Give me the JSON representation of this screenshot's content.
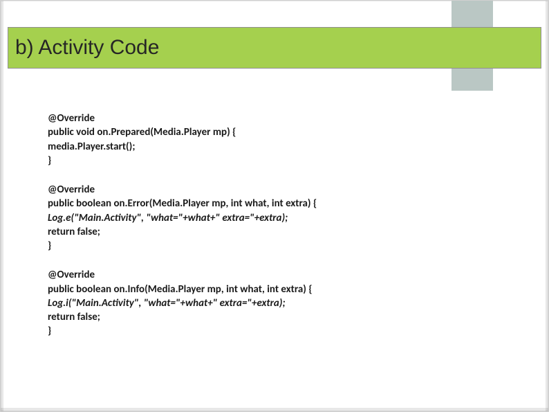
{
  "title": "b) Activity Code",
  "blocks": [
    {
      "lines": [
        {
          "text": "@Override",
          "style": "bold"
        },
        {
          "text": "public void on.Prepared(Media.Player mp) {",
          "style": "bold"
        },
        {
          "text": "media.Player.start();",
          "style": "bold"
        },
        {
          "text": "}",
          "style": "bold"
        }
      ]
    },
    {
      "lines": [
        {
          "text": "@Override",
          "style": "bold"
        },
        {
          "text": "public boolean on.Error(Media.Player mp, int what, int extra) {",
          "style": "bold"
        },
        {
          "text": "Log.e(\"Main.Activity\", \"what=\"+what+\" extra=\"+extra);",
          "style": "italic"
        },
        {
          "text": "return false;",
          "style": "bold"
        },
        {
          "text": "}",
          "style": "bold"
        }
      ]
    },
    {
      "lines": [
        {
          "text": "@Override",
          "style": "bold"
        },
        {
          "text": "public boolean on.Info(Media.Player mp, int what, int extra) {",
          "style": "bold"
        },
        {
          "text": "Log.i(\"Main.Activity\", \"what=\"+what+\" extra=\"+extra);",
          "style": "italic"
        },
        {
          "text": "return false;",
          "style": "bold"
        },
        {
          "text": "}",
          "style": "bold"
        }
      ]
    }
  ]
}
